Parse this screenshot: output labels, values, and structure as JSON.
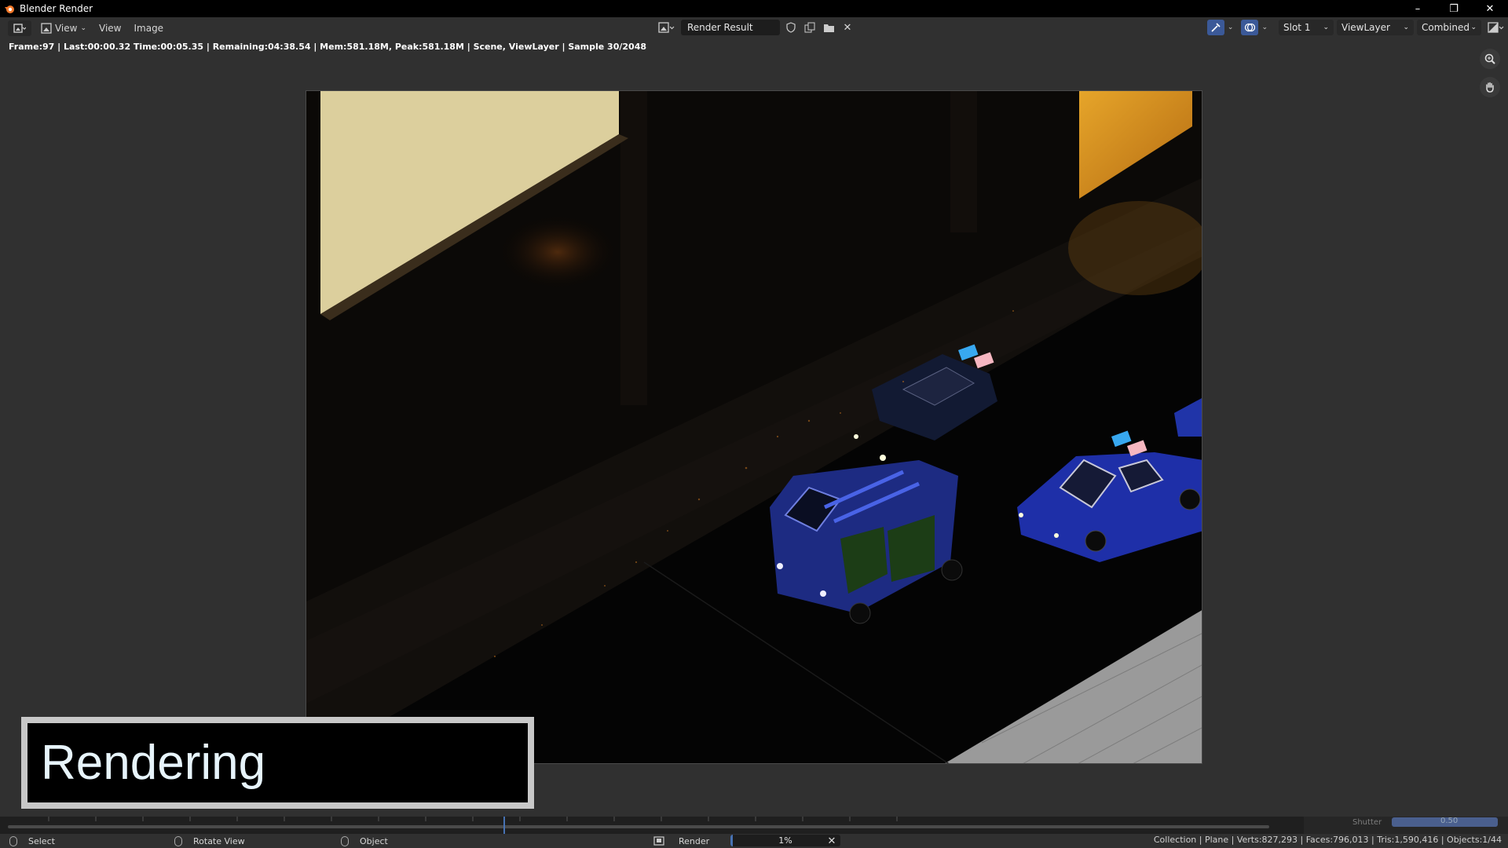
{
  "window": {
    "title": "Blender Render"
  },
  "header": {
    "mode_label": "View",
    "menus": [
      "View",
      "Image"
    ],
    "image_name": "Render Result",
    "slot": "Slot 1",
    "view_layer": "ViewLayer",
    "pass": "Combined"
  },
  "stats_text": "Frame:97 | Last:00:00.32 Time:00:05.35 | Remaining:04:38.54 | Mem:581.18M, Peak:581.18M | Scene, ViewLayer | Sample 30/2048",
  "overlay_text": "Rendering",
  "timeline": {
    "shutter_label": "Shutter",
    "shutter_value": "0.50"
  },
  "statusbar": {
    "select": "Select",
    "rotate": "Rotate View",
    "object": "Object",
    "render_label": "Render",
    "progress_text": "1%",
    "progress_fraction": 0.01,
    "scene_stats": "Collection | Plane | Verts:827,293 | Faces:796,013 | Tris:1,590,416 | Objects:1/44"
  },
  "colors": {
    "accent": "#4772b3",
    "background": "#303030"
  }
}
